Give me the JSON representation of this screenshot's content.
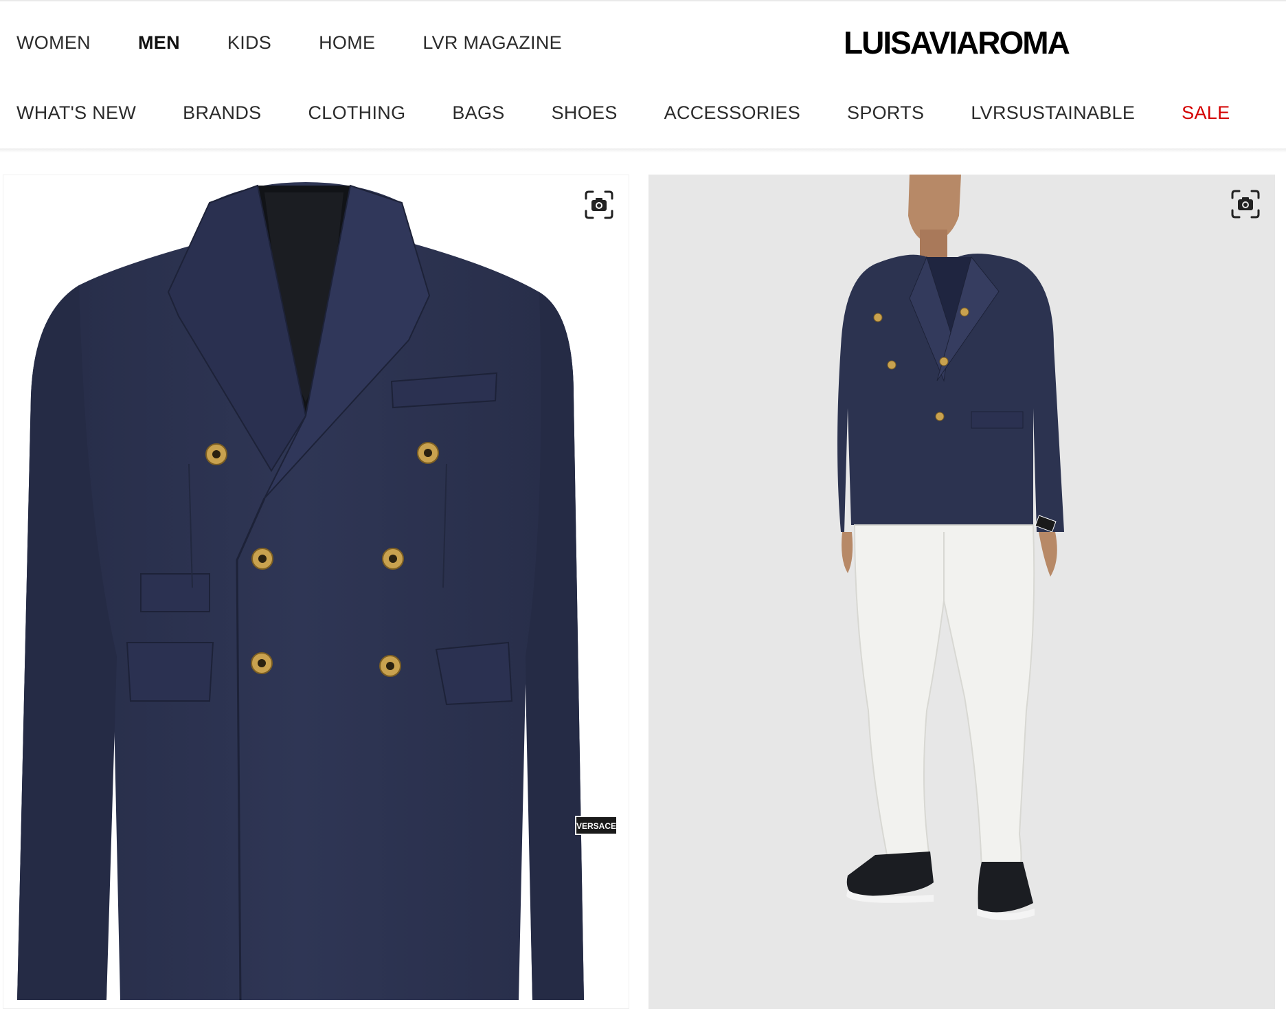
{
  "brand": {
    "logo_text": "LUISAVIAROMA"
  },
  "primary_nav": {
    "items": [
      {
        "label": "WOMEN",
        "active": false
      },
      {
        "label": "MEN",
        "active": true
      },
      {
        "label": "KIDS",
        "active": false
      },
      {
        "label": "HOME",
        "active": false
      },
      {
        "label": "LVR MAGAZINE",
        "active": false
      }
    ]
  },
  "category_nav": {
    "items": [
      {
        "label": "WHAT'S NEW"
      },
      {
        "label": "BRANDS"
      },
      {
        "label": "CLOTHING"
      },
      {
        "label": "BAGS"
      },
      {
        "label": "SHOES"
      },
      {
        "label": "ACCESSORIES"
      },
      {
        "label": "SPORTS"
      },
      {
        "label": "LVRSUSTAINABLE"
      },
      {
        "label": "SALE",
        "color": "#d40000"
      }
    ]
  },
  "gallery": {
    "images": [
      {
        "name": "product-image-jacket",
        "zoom_icon": "camera-zoom-icon"
      },
      {
        "name": "product-image-model",
        "zoom_icon": "camera-zoom-icon"
      }
    ],
    "label_tag_text": "VERSACE"
  },
  "colors": {
    "navy": "#2c3350",
    "navy_dark": "#1f2540",
    "gold": "#c9a24f",
    "sale": "#d40000",
    "model_bg": "#e7e7e7"
  }
}
